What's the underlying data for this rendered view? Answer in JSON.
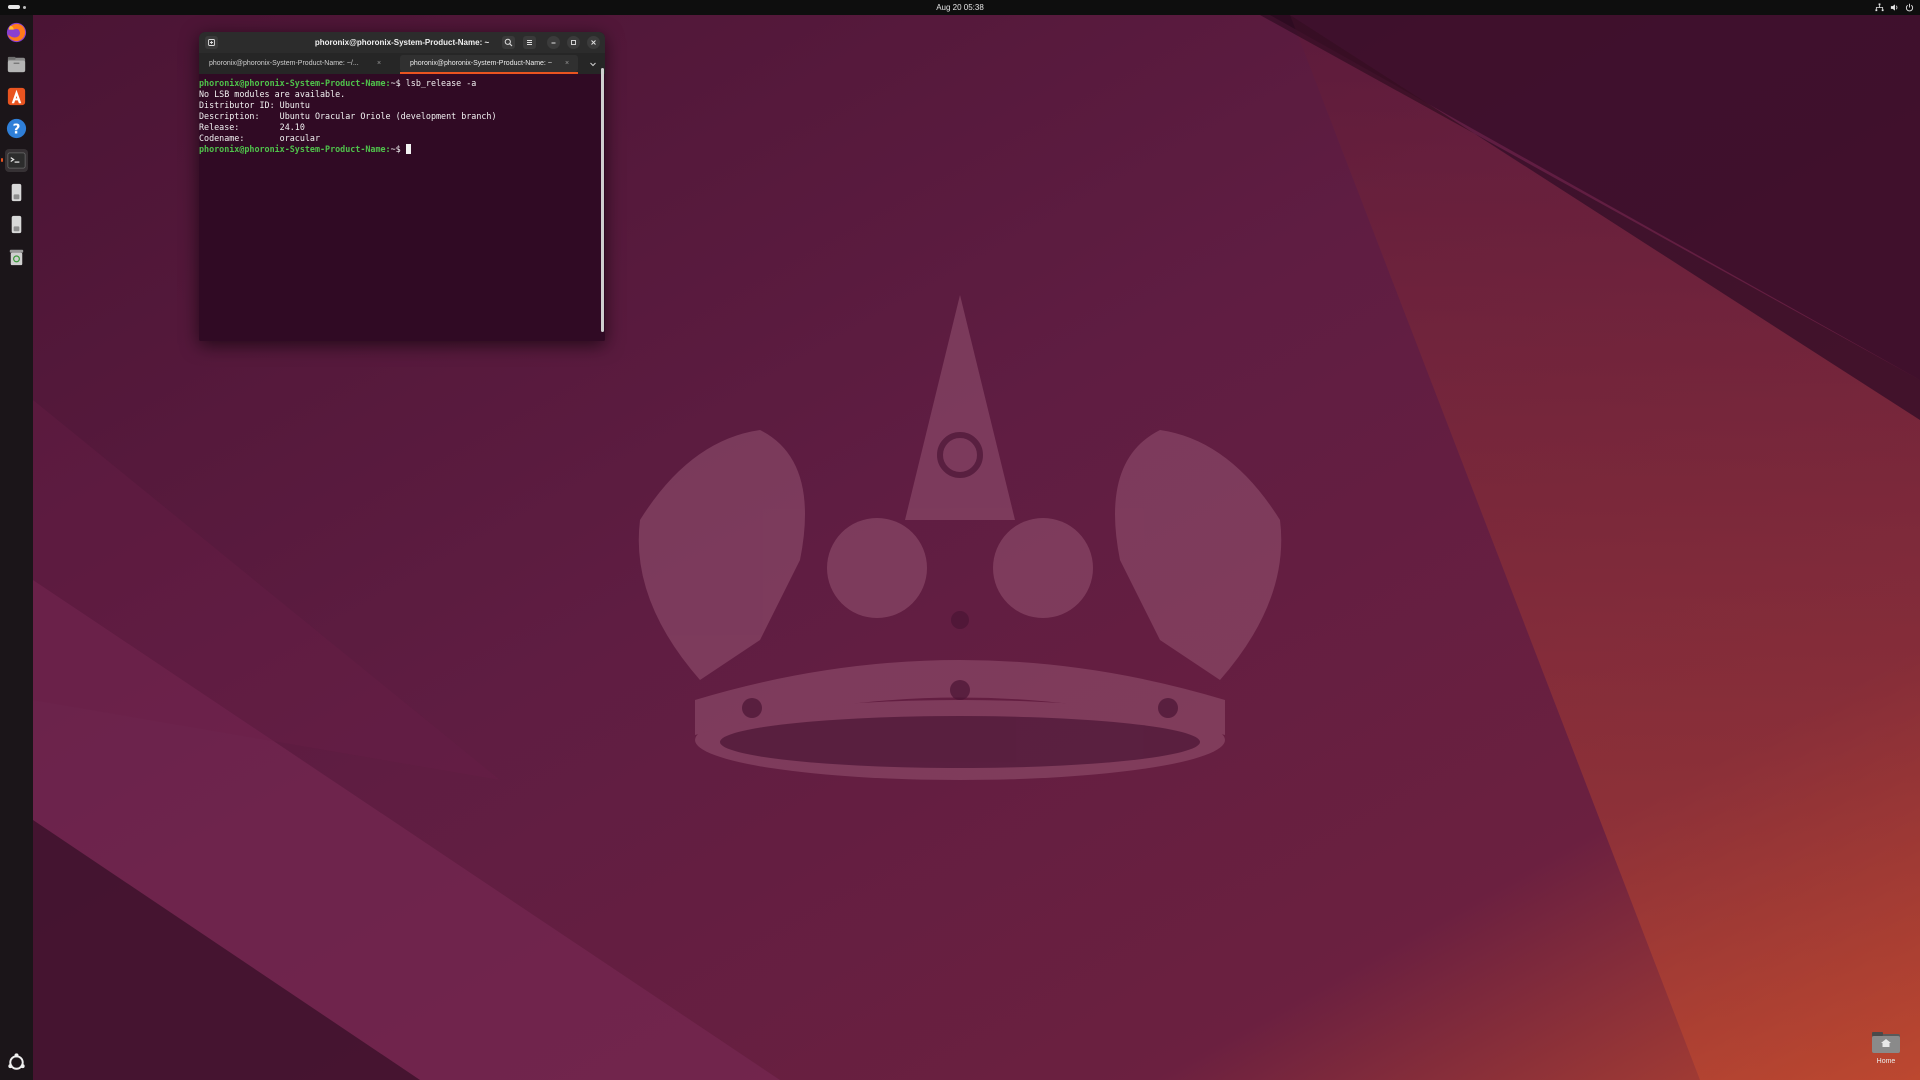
{
  "topbar": {
    "clock": "Aug 20  05:38",
    "tray_icons": [
      "network-icon",
      "volume-icon",
      "power-icon"
    ]
  },
  "dock": {
    "items": [
      {
        "name": "firefox",
        "icon": "firefox-icon"
      },
      {
        "name": "files",
        "icon": "files-icon"
      },
      {
        "name": "app-center",
        "icon": "app-center-icon"
      },
      {
        "name": "help",
        "icon": "help-icon"
      },
      {
        "name": "terminal",
        "icon": "terminal-icon",
        "active": true
      },
      {
        "name": "usb-drive-1",
        "icon": "usb-drive-icon"
      },
      {
        "name": "usb-drive-2",
        "icon": "usb-drive-icon"
      },
      {
        "name": "trash",
        "icon": "trash-icon"
      }
    ],
    "show_apps_icon": "ubuntu-logo-icon"
  },
  "terminal": {
    "title": "phoronix@phoronix-System-Product-Name: ~",
    "tabs": [
      {
        "label": "phoronix@phoronix-System-Product-Name: ~/...",
        "active": false
      },
      {
        "label": "phoronix@phoronix-System-Product-Name: ~",
        "active": true
      }
    ],
    "prompt": "phoronix@phoronix-System-Product-Name:",
    "prompt_suffix": "~$ ",
    "lines": [
      {
        "type": "prompt",
        "command": "lsb_release -a"
      },
      {
        "type": "output",
        "text": "No LSB modules are available."
      },
      {
        "type": "output",
        "text": "Distributor ID: Ubuntu"
      },
      {
        "type": "output",
        "text": "Description:    Ubuntu Oracular Oriole (development branch)"
      },
      {
        "type": "output",
        "text": "Release:        24.10"
      },
      {
        "type": "output",
        "text": "Codename:       oracular"
      },
      {
        "type": "prompt",
        "command": "",
        "cursor": true
      }
    ]
  },
  "desktop": {
    "home_label": "Home"
  },
  "colors": {
    "accent": "#e95420",
    "terminal_bg": "#300a24",
    "prompt_green": "#4fc24b"
  }
}
